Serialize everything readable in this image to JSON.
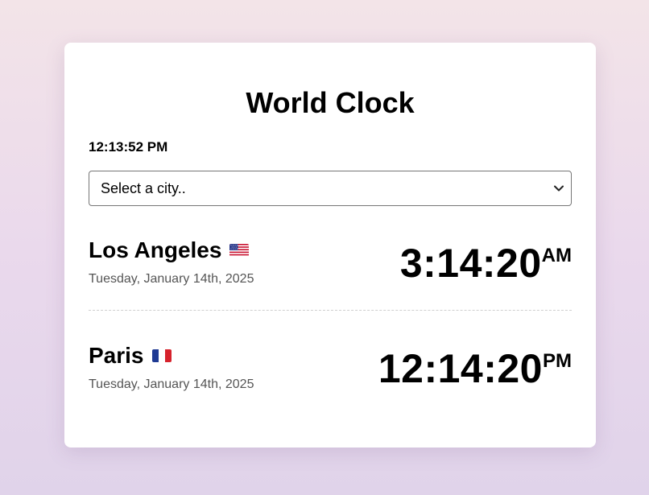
{
  "app": {
    "title": "World Clock",
    "local_time": "12:13:52 PM"
  },
  "city_select": {
    "selected_label": "Select a city.."
  },
  "cities": [
    {
      "name": "Los Angeles",
      "flag": "flag-us-icon",
      "date": "Tuesday, January 14th, 2025",
      "time": "3:14:20",
      "ampm": "AM"
    },
    {
      "name": "Paris",
      "flag": "flag-fr-icon",
      "date": "Tuesday, January 14th, 2025",
      "time": "12:14:20",
      "ampm": "PM"
    }
  ],
  "colors": {
    "background_top": "#f3e4e8",
    "background_bottom": "#e0d3ea",
    "card": "#ffffff",
    "date_text": "#555555",
    "divider": "#cfcfcf"
  }
}
